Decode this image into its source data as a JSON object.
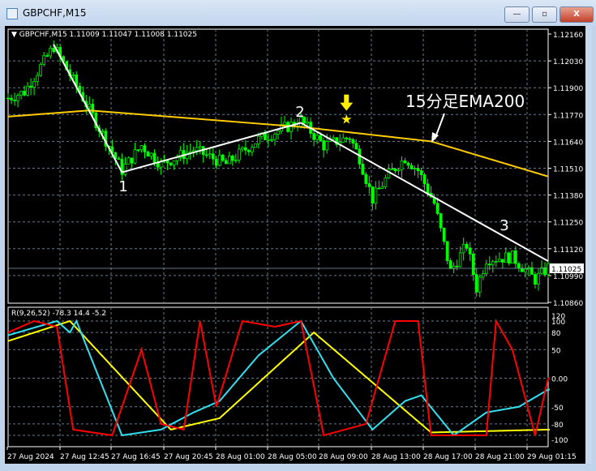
{
  "window": {
    "title": "GBPCHF,M15",
    "minimize": "—",
    "restore": "▫",
    "close": "X"
  },
  "chart_header": "GBPCHF,M15  1.11009 1.11047 1.11008 1.11025",
  "indicator_header": "R(9,26,52) -78.3 14.4 -5.2",
  "annotation": {
    "label": "15分足EMA200",
    "points": [
      "1",
      "2",
      "3"
    ]
  },
  "colors": {
    "bull": "#00ff00",
    "ema": "#ffcc00",
    "red": "#ff0000",
    "cyan": "#33e0f0",
    "yellow": "#ffff00",
    "trend": "#ffffff"
  },
  "chart_data": {
    "type": "candlestick",
    "symbol": "GBPCHF",
    "timeframe": "M15",
    "price_ticks": [
      "1.12160",
      "1.12030",
      "1.11900",
      "1.11770",
      "1.11640",
      "1.11510",
      "1.11380",
      "1.11250",
      "1.11120",
      "1.10990",
      "1.10860"
    ],
    "ylim": [
      1.1086,
      1.1216
    ],
    "current_price": "1.11025",
    "time_ticks": [
      "27 Aug 2024",
      "27 Aug 12:45",
      "27 Aug 16:45",
      "27 Aug 20:45",
      "28 Aug 01:00",
      "28 Aug 05:00",
      "28 Aug 09:00",
      "28 Aug 13:00",
      "28 Aug 17:00",
      "28 Aug 21:00",
      "29 Aug 01:15"
    ],
    "bars": 167,
    "price_path": [
      [
        0,
        1.1185
      ],
      [
        5,
        1.1188
      ],
      [
        14,
        1.121
      ],
      [
        22,
        1.1188
      ],
      [
        35,
        1.115
      ],
      [
        41,
        1.1162
      ],
      [
        47,
        1.1153
      ],
      [
        57,
        1.116
      ],
      [
        67,
        1.1153
      ],
      [
        77,
        1.1165
      ],
      [
        90,
        1.1174
      ],
      [
        97,
        1.1162
      ],
      [
        105,
        1.1166
      ],
      [
        108,
        1.1156
      ],
      [
        112,
        1.1136
      ],
      [
        117,
        1.1148
      ],
      [
        122,
        1.1156
      ],
      [
        126,
        1.115
      ],
      [
        131,
        1.1134
      ],
      [
        134,
        1.1114
      ],
      [
        136,
        1.1101
      ],
      [
        141,
        1.1114
      ],
      [
        144,
        1.1093
      ],
      [
        147,
        1.1107
      ],
      [
        155,
        1.1108
      ],
      [
        162,
        1.1097
      ],
      [
        166,
        1.1103
      ]
    ],
    "ema200": [
      [
        0,
        1.1176
      ],
      [
        25,
        1.1179
      ],
      [
        90,
        1.1171
      ],
      [
        130,
        1.1164
      ],
      [
        166,
        1.1147
      ]
    ],
    "trendlines": [
      [
        [
          14,
          1.1211
        ],
        [
          35,
          1.1149
        ]
      ],
      [
        [
          35,
          1.1149
        ],
        [
          90,
          1.1173
        ]
      ],
      [
        [
          90,
          1.1173
        ],
        [
          166,
          1.1106
        ]
      ]
    ],
    "star_marker": [
      104,
      1.1171
    ],
    "indicator": {
      "ylim": [
        -120,
        120
      ],
      "ticks": [
        "120",
        "100",
        "80",
        "50",
        "0.00",
        "-50",
        "-80",
        "-100"
      ],
      "tick_values": [
        120,
        100,
        80,
        50,
        0,
        -50,
        -80,
        -100
      ],
      "red": [
        [
          0,
          80
        ],
        [
          8,
          100
        ],
        [
          15,
          90
        ],
        [
          20,
          -90
        ],
        [
          32,
          -100
        ],
        [
          41,
          50
        ],
        [
          47,
          -80
        ],
        [
          54,
          -90
        ],
        [
          59,
          100
        ],
        [
          64,
          -50
        ],
        [
          72,
          100
        ],
        [
          82,
          90
        ],
        [
          90,
          100
        ],
        [
          97,
          -100
        ],
        [
          110,
          -80
        ],
        [
          119,
          100
        ],
        [
          126,
          100
        ],
        [
          130,
          -100
        ],
        [
          147,
          -100
        ],
        [
          150,
          100
        ],
        [
          155,
          50
        ],
        [
          162,
          -100
        ],
        [
          166,
          0
        ]
      ],
      "cyan": [
        [
          0,
          75
        ],
        [
          15,
          100
        ],
        [
          19,
          80
        ],
        [
          21,
          100
        ],
        [
          35,
          -100
        ],
        [
          47,
          -90
        ],
        [
          57,
          -60
        ],
        [
          65,
          -40
        ],
        [
          77,
          40
        ],
        [
          90,
          100
        ],
        [
          100,
          0
        ],
        [
          112,
          -90
        ],
        [
          122,
          -40
        ],
        [
          127,
          -30
        ],
        [
          137,
          -100
        ],
        [
          147,
          -60
        ],
        [
          157,
          -50
        ],
        [
          166,
          -20
        ]
      ],
      "yellow": [
        [
          0,
          65
        ],
        [
          19,
          100
        ],
        [
          50,
          -90
        ],
        [
          65,
          -70
        ],
        [
          94,
          80
        ],
        [
          130,
          -95
        ],
        [
          166,
          -90
        ]
      ]
    }
  }
}
